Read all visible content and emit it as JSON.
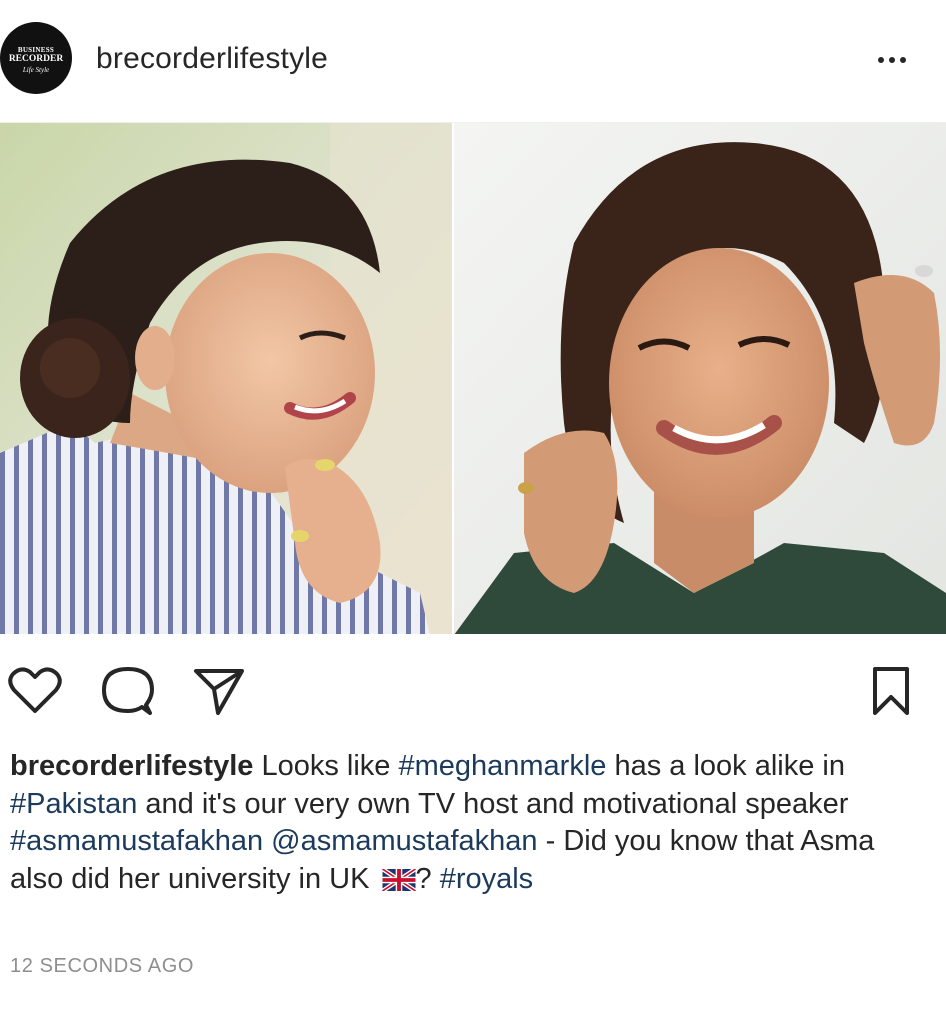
{
  "header": {
    "username": "brecorderlifestyle",
    "avatar_lines": [
      "BUSINESS",
      "RECORDER",
      "Life Style"
    ],
    "more_icon": "ellipsis-icon"
  },
  "post": {
    "image_description_icons": [
      "photo-left",
      "photo-right"
    ]
  },
  "actions": {
    "like_icon": "heart-icon",
    "comment_icon": "comment-icon",
    "share_icon": "paper-plane-icon",
    "save_icon": "bookmark-icon"
  },
  "caption": {
    "username": "brecorderlifestyle",
    "t1": " Looks like ",
    "tag1": "#meghanmarkle",
    "t2": " has a look alike in ",
    "tag2": "#Pakistan",
    "t3": " and it's our very own TV host and motivational speaker ",
    "tag3": "#asmamustafakhan",
    "t4": " ",
    "mention": "@asmamustafakhan",
    "t5": " - Did you know that Asma also did her university in UK ",
    "t6": "? ",
    "tag4": "#royals"
  },
  "timestamp": "12 SECONDS AGO",
  "colors": {
    "link": "#1b3a5c",
    "text": "#262626",
    "muted": "#8e8e8e"
  }
}
